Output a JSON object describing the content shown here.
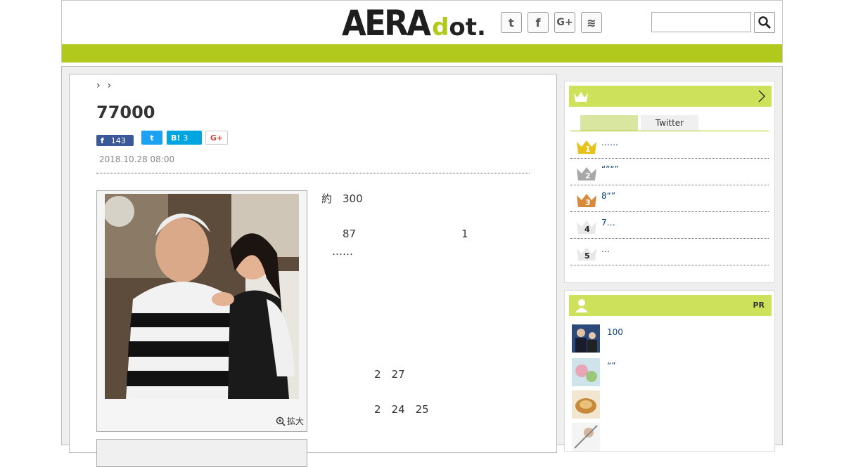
{
  "header": {
    "logo_main": "AERA",
    "logo_sub_dot": "d",
    "logo_sub_rest": "ot.",
    "social": [
      "twitter-icon",
      "facebook-icon",
      "google-plus-icon",
      "rss-icon"
    ],
    "social_labels": [
      "t",
      "f",
      "G+",
      "≋"
    ],
    "search_placeholder": ""
  },
  "article": {
    "breadcrumb_sep1": "›",
    "breadcrumb_sep2": "›",
    "title": "77000",
    "share": {
      "facebook_label": "f",
      "facebook_count": "143",
      "twitter_label": "t",
      "hatena_label": "B!",
      "hatena_count": "3",
      "google_label": "G+"
    },
    "date": "2018.10.28 08:00",
    "zoom_label": "拡大",
    "paragraphs": [
      {
        "type": "text",
        "lines": [
          "約　300　　　　　　　　　　　　　　　　　　",
          "　　　　　　　　　　　　　　　　　　　　　　",
          "　　87　　　　　　　　　　1　　　　　　　　",
          "　……　"
        ]
      },
      {
        "type": "link",
        "lines": [
          "　　　　　　　　　　　　　　　　　"
        ]
      },
      {
        "type": "text",
        "lines": [
          "　　　　　　　　　　　　　　　　　"
        ]
      },
      {
        "type": "text",
        "lines": [
          "　　　　　　　　　　　　　　　　　　　　　　",
          "　　　　　2　27　　　　　　　"
        ]
      },
      {
        "type": "text",
        "lines": [
          "　　　　　2　24　25　　　　　　　　　　　　　",
          "　　　　　　　　　　　　　　　　　　　　　　",
          "　　　　　　　　　　　　　　　　　　　　　　"
        ]
      }
    ]
  },
  "ranking": {
    "tab_first": "",
    "tab_second": "Twitter",
    "items": [
      {
        "rank": "1",
        "text": "……",
        "color": "#e6c21a"
      },
      {
        "rank": "2",
        "text": "“”“”",
        "color": "#a8a8a8"
      },
      {
        "rank": "3",
        "text": "8“”",
        "color": "#d9893a"
      },
      {
        "rank": "4",
        "text": "7…",
        "color": "#e8e8e8"
      },
      {
        "rank": "5",
        "text": "…",
        "color": "#e8e8e8"
      }
    ]
  },
  "pr": {
    "label": "PR",
    "items": [
      {
        "text": "100"
      },
      {
        "text": "“”"
      },
      {
        "text": ""
      },
      {
        "text": ""
      }
    ]
  },
  "colors": {
    "accent": "#b1c91c",
    "side_head": "#cde15a",
    "link": "#0d3f78"
  }
}
